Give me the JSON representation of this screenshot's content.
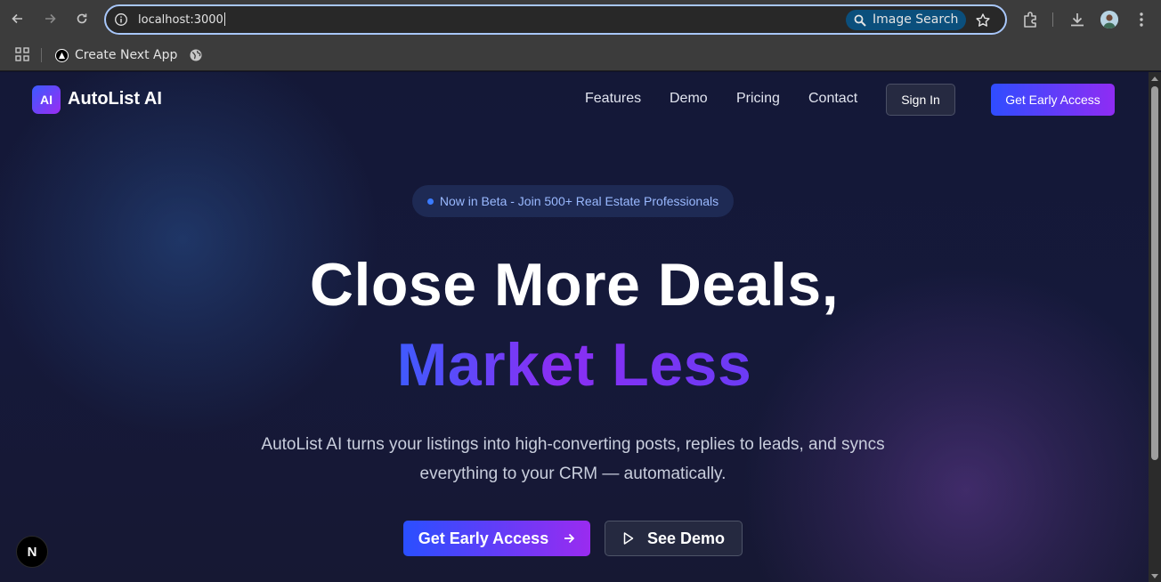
{
  "browser": {
    "url": "localhost:3000",
    "image_search_label": "Image Search",
    "bookmark_label": "Create Next App"
  },
  "site": {
    "logo_badge": "AI",
    "logo_text": "AutoList AI",
    "nav": {
      "features": "Features",
      "demo": "Demo",
      "pricing": "Pricing",
      "contact": "Contact",
      "sign_in": "Sign In",
      "early_access": "Get Early Access"
    },
    "hero": {
      "beta_pill": "Now in Beta - Join 500+ Real Estate Professionals",
      "headline_line1": "Close More Deals,",
      "headline_line2": "Market Less",
      "subtitle": "AutoList AI turns your listings into high-converting posts, replies to leads, and syncs everything to your CRM — automatically.",
      "cta_primary": "Get Early Access",
      "cta_secondary": "See Demo"
    },
    "next_badge": "N"
  },
  "colors": {
    "brand_gradient_start": "#2f4dff",
    "brand_gradient_end": "#9b2cf2",
    "page_background": "#141837"
  }
}
